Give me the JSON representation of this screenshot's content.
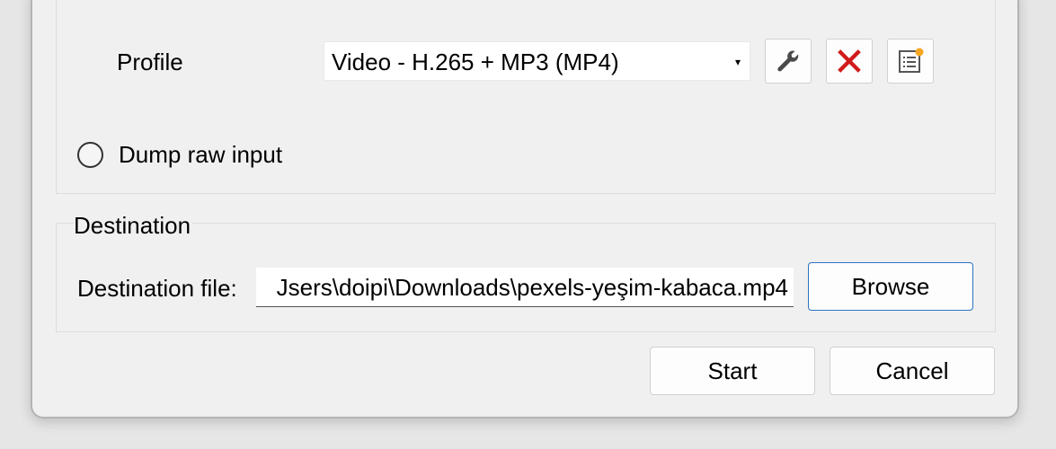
{
  "profile": {
    "label": "Profile",
    "selected": "Video - H.265 + MP3 (MP4)",
    "dropdown_arrow": "▾",
    "actions": [
      {
        "icon": "wrench-icon",
        "tooltip": "Edit selected profile"
      },
      {
        "icon": "delete-x-icon",
        "tooltip": "Delete selected profile"
      },
      {
        "icon": "new-profile-icon",
        "tooltip": "Create a new profile"
      }
    ],
    "delete_color": "#d11a1a",
    "new_badge_color": "#f5a623"
  },
  "dump_raw": {
    "label": "Dump raw input",
    "checked": false
  },
  "destination": {
    "title": "Destination",
    "file_label": "Destination file:",
    "file_value": "Jsers\\doipi\\Downloads\\pexels-yeşim-kabaca.mp4",
    "browse_label": "Browse"
  },
  "footer": {
    "start_label": "Start",
    "cancel_label": "Cancel"
  },
  "accent_color": "#2a72c4"
}
